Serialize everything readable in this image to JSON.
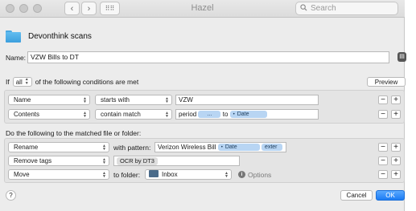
{
  "window": {
    "title": "Hazel",
    "search_placeholder": "Search"
  },
  "folder": {
    "name": "Devonthink scans"
  },
  "rule": {
    "name_label": "Name:",
    "name_value": "VZW Bills to DT"
  },
  "conditions": {
    "if_label": "If",
    "match_select": "all",
    "suffix": "of the following conditions are met",
    "preview_label": "Preview",
    "rows": [
      {
        "attribute": "Name",
        "operator": "starts with",
        "value": "VZW"
      },
      {
        "attribute": "Contents",
        "operator": "contain match",
        "text_before": "period",
        "token1": "...",
        "text_between": "to",
        "token2": "Date"
      }
    ]
  },
  "actions": {
    "header": "Do the following to the matched file or folder:",
    "rows": [
      {
        "action": "Rename",
        "label": "with pattern:",
        "text": "Verizon Wireless Bill",
        "token1": "Date",
        "token2": "exter"
      },
      {
        "action": "Remove tags",
        "tag": "OCR by DT3"
      },
      {
        "action": "Move",
        "label": "to folder:",
        "folder": "Inbox",
        "options_label": "Options"
      }
    ]
  },
  "footer": {
    "help": "?",
    "cancel": "Cancel",
    "ok": "OK"
  },
  "symbols": {
    "minus": "−",
    "plus": "+",
    "token_dot": "•"
  },
  "colors": {
    "accent": "#1c7cf4",
    "token": "#b8d5f3",
    "folder": "#3b9fdd"
  }
}
